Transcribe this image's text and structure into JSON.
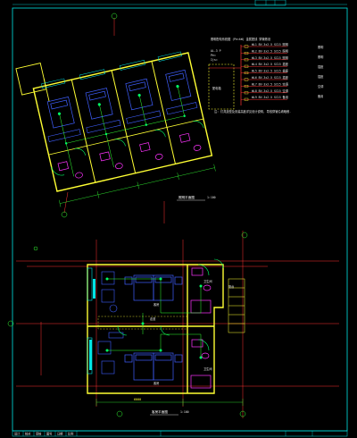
{
  "drawing": {
    "colors": {
      "background": "#000000",
      "frame": "#00e5e5",
      "wall": "#ffff33",
      "door": "#00ff66",
      "furniture": "#3f5fff",
      "fixture": "#ff33ff",
      "axis": "#ff3333",
      "dimension": "#33ff33",
      "text": "#ffffff"
    },
    "upper_plan_caption": "照明平面图",
    "upper_plan_scale": "1:100",
    "lower_plan_caption": "客房平面图",
    "lower_plan_scale": "1:100",
    "schematic": {
      "title": "照明配电系统图 (Pe=kW)  金属配线 穿管敷设",
      "incoming": [
        "AL-3  P",
        "Pe=",
        "Ijs="
      ],
      "panel_label": "配电箱",
      "circuits": [
        "WL1 BV-3x2.5 SC15 照明",
        "WL2 BV-3x2.5 SC15 照明",
        "WL3 BV-3x2.5 SC15 照明",
        "WL4 BV-3x2.5 SC15 插座",
        "WL5 BV-3x2.5 SC15 插座",
        "WL6 BV-3x2.5 SC15 插座",
        "WL7 BV-3x2.5 SC15 空调",
        "WL8 BV-3x2.5 SC15 空调",
        "WL9 BV-3x2.5 SC15 备用"
      ],
      "right_labels": [
        "照明",
        "照明",
        "插座",
        "插座",
        "空调",
        "备用"
      ],
      "note": "注: 灯具选型及安装高度详见设计说明, 导线穿管沿墙暗敷."
    },
    "lower_plan_rooms": [
      "卫生间",
      "客房",
      "卫生间",
      "客房",
      "走道",
      "阳台"
    ],
    "lower_plan_dim": "6000",
    "title_block": [
      "设计",
      "校对",
      "审核",
      "图号",
      "日期",
      "比例"
    ]
  }
}
